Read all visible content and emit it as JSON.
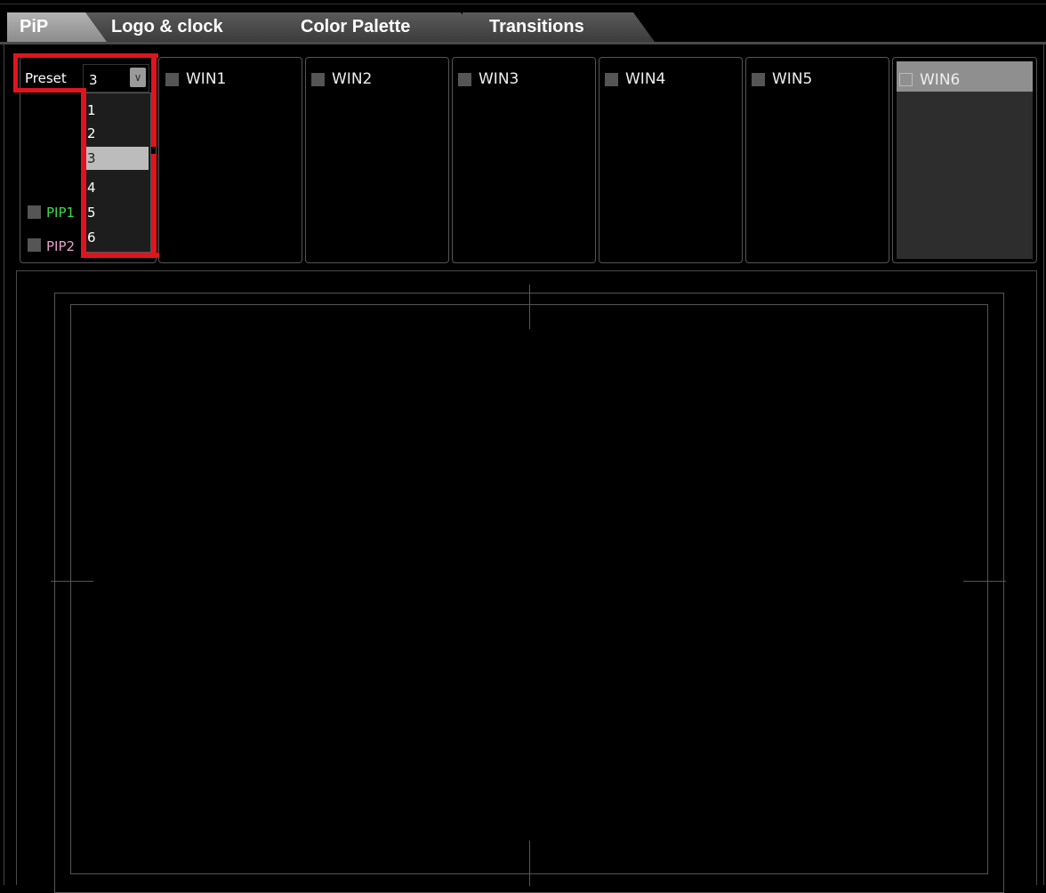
{
  "tabs": [
    {
      "label": "PiP",
      "active": true
    },
    {
      "label": "Logo & clock",
      "active": false
    },
    {
      "label": "Color Palette",
      "active": false
    },
    {
      "label": "Transitions",
      "active": false
    }
  ],
  "preset": {
    "label": "Preset",
    "value": "3",
    "options": [
      "1",
      "2",
      "3",
      "4",
      "5",
      "6"
    ],
    "selected": "3"
  },
  "pips": [
    {
      "label": "PIP1",
      "color": "#3cdc50"
    },
    {
      "label": "PIP2",
      "color": "#e8a0c8"
    }
  ],
  "windows": [
    {
      "label": "WIN1"
    },
    {
      "label": "WIN2"
    },
    {
      "label": "WIN3"
    },
    {
      "label": "WIN4"
    },
    {
      "label": "WIN5"
    },
    {
      "label": "WIN6",
      "selected": true
    }
  ],
  "colors": {
    "annotation": "#e0141e",
    "background": "#000000",
    "selected_window": "#8f8f8f"
  }
}
